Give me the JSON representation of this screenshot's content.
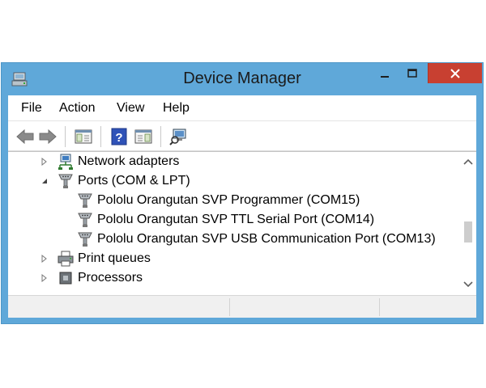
{
  "window": {
    "title": "Device Manager",
    "accent_color": "#5fa8d9",
    "close_color": "#c84031"
  },
  "menu": {
    "items": [
      "File",
      "Action",
      "View",
      "Help"
    ]
  },
  "toolbar": {
    "buttons": [
      "back-icon",
      "forward-icon",
      "show-hide-console-tree-icon",
      "help-icon",
      "properties-pane-icon",
      "scan-hardware-icon"
    ]
  },
  "tree": {
    "network_adapters": "Network adapters",
    "ports": "Ports (COM & LPT)",
    "port_children": [
      "Pololu Orangutan SVP Programmer (COM15)",
      "Pololu Orangutan SVP TTL Serial Port (COM14)",
      "Pololu Orangutan SVP USB Communication Port (COM13)"
    ],
    "print_queues": "Print queues",
    "processors": "Processors"
  }
}
